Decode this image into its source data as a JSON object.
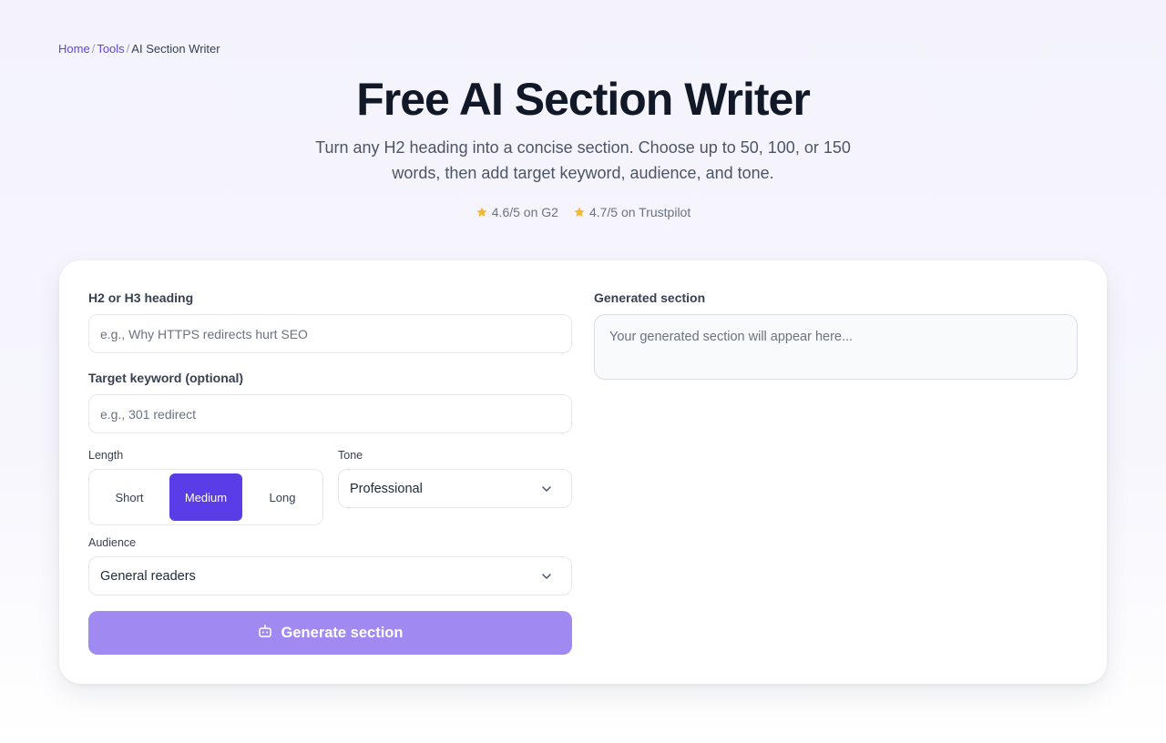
{
  "breadcrumb": {
    "home": "Home",
    "tools": "Tools",
    "current": "AI Section Writer",
    "separator": "/"
  },
  "hero": {
    "title": "Free AI Section Writer",
    "subtitle": "Turn any H2 heading into a concise section. Choose up to 50, 100, or 150 words, then add target keyword, audience, and tone."
  },
  "ratings": [
    {
      "text": "4.6/5 on G2",
      "icon": "star-icon"
    },
    {
      "text": "4.7/5 on Trustpilot",
      "icon": "star-icon"
    }
  ],
  "form": {
    "heading_label": "H2 or H3 heading",
    "heading_placeholder": "e.g., Why HTTPS redirects hurt SEO",
    "keyword_label": "Target keyword (optional)",
    "keyword_placeholder": "e.g., 301 redirect",
    "length_label": "Length",
    "length_options": [
      "Short",
      "Medium",
      "Long"
    ],
    "length_selected": "Medium",
    "tone_label": "Tone",
    "tone_value": "Professional",
    "audience_label": "Audience",
    "audience_value": "General readers",
    "generate_label": "Generate section"
  },
  "output": {
    "label": "Generated section",
    "placeholder": "Your generated section will appear here..."
  },
  "colors": {
    "accent": "#5b3de8",
    "accent_light": "#a08af2",
    "link": "#5b46e0",
    "star": "#f5b82e"
  }
}
